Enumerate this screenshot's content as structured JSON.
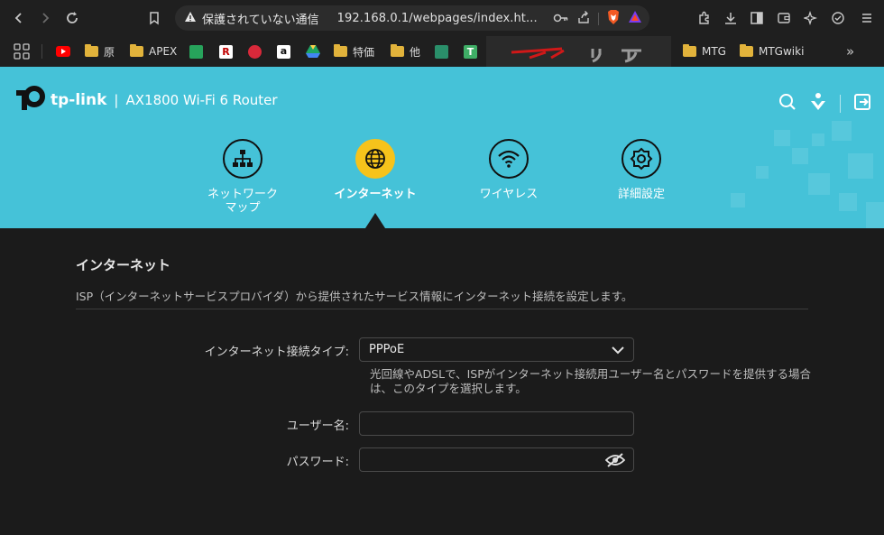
{
  "browser": {
    "security_label": "保護されていない通信",
    "url": "192.168.0.1/webpages/index.ht...",
    "bookmarks": [
      {
        "label": "原"
      },
      {
        "label": "APEX"
      },
      {
        "label": "特価"
      },
      {
        "label": "他"
      },
      {
        "label": "MTG"
      },
      {
        "label": "MTGwiki"
      }
    ]
  },
  "router": {
    "brand": "tp-link",
    "separator": "|",
    "model": "AX1800 Wi-Fi 6 Router",
    "nav": [
      {
        "label": "ネットワーク\nマップ",
        "icon": "network-map-icon"
      },
      {
        "label": "インターネット",
        "icon": "globe-icon"
      },
      {
        "label": "ワイヤレス",
        "icon": "wifi-icon"
      },
      {
        "label": "詳細設定",
        "icon": "gear-icon"
      }
    ],
    "active_nav": "インターネット",
    "accent_color": "#45c2d8",
    "active_color": "#f6c31b"
  },
  "section": {
    "title": "インターネット",
    "description": "ISP（インターネットサービスプロバイダ）から提供されたサービス情報にインターネット接続を設定します。"
  },
  "form": {
    "connection_type_label": "インターネット接続タイプ:",
    "connection_type_value": "PPPoE",
    "hint": "光回線やADSLで、ISPがインターネット接続用ユーザー名とパスワードを提供する場合は、このタイプを選択します。",
    "username_label": "ユーザー名:",
    "username_value": "",
    "password_label": "パスワード:",
    "password_value": ""
  }
}
